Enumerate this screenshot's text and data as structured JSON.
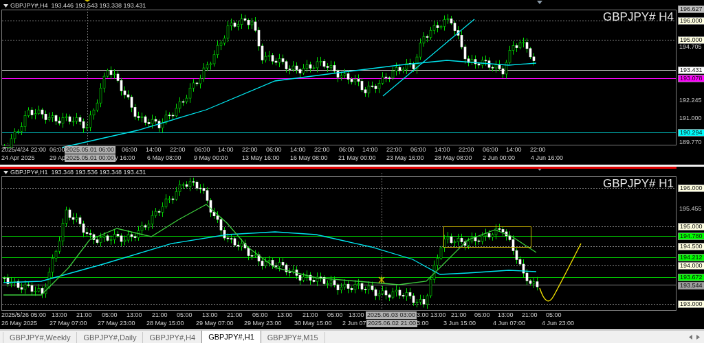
{
  "panes": [
    {
      "header": "GBPJPY#,H4  193.446 193.543 193.338 193.431",
      "title": "GBPJPY# H4",
      "active": false,
      "price_labels": [
        {
          "text": "196.627",
          "kind": "tag",
          "color": "#c0c0c0"
        },
        {
          "text": "196.000",
          "kind": "tag",
          "color": "#ffffe1"
        },
        {
          "text": "195.000",
          "kind": "tag",
          "color": "#ffffe1"
        },
        {
          "text": "194.705",
          "kind": "plain"
        },
        {
          "text": "193.431",
          "kind": "tag",
          "color": "#ffffff"
        },
        {
          "text": "193.078",
          "kind": "tag",
          "color": "#ff00ff"
        },
        {
          "text": "192.245",
          "kind": "plain"
        },
        {
          "text": "191.000",
          "kind": "plain"
        },
        {
          "text": "190.294",
          "kind": "tag",
          "color": "#00ffff"
        },
        {
          "text": "189.770",
          "kind": "plain"
        }
      ],
      "time_row_1": [
        {
          "text": "2025/4/24 22:00",
          "kind": "tick"
        },
        {
          "text": "06:00",
          "kind": "tick"
        },
        {
          "text": "2025.05.01 06:00",
          "kind": "crosshair"
        },
        {
          "text": "06:00",
          "kind": "tick"
        },
        {
          "text": "14:00",
          "kind": "tick"
        },
        {
          "text": "22:00",
          "kind": "tick"
        },
        {
          "text": "06:00",
          "kind": "tick"
        },
        {
          "text": "14:00",
          "kind": "tick"
        },
        {
          "text": "22:00",
          "kind": "tick"
        },
        {
          "text": "06:00",
          "kind": "tick"
        },
        {
          "text": "14:00",
          "kind": "tick"
        },
        {
          "text": "22:00",
          "kind": "tick"
        },
        {
          "text": "06:00",
          "kind": "tick"
        },
        {
          "text": "14:00",
          "kind": "tick"
        },
        {
          "text": "22:00",
          "kind": "tick"
        },
        {
          "text": "06:00",
          "kind": "tick"
        },
        {
          "text": "14:00",
          "kind": "tick"
        },
        {
          "text": "22:00",
          "kind": "tick"
        },
        {
          "text": "06:00",
          "kind": "tick"
        },
        {
          "text": "14:00",
          "kind": "tick"
        },
        {
          "text": "22:00",
          "kind": "tick"
        }
      ],
      "time_row_2": [
        {
          "text": "24 Apr 2025",
          "kind": "tick"
        },
        {
          "text": "29 Ap",
          "kind": "tick"
        },
        {
          "text": "2025.05.01 00:00",
          "kind": "crosshair"
        },
        {
          "text": "y 16:00",
          "kind": "tick"
        },
        {
          "text": "6 May 08:00",
          "kind": "tick"
        },
        {
          "text": "9 May 00:00",
          "kind": "tick"
        },
        {
          "text": "13 May 16:00",
          "kind": "tick"
        },
        {
          "text": "16 May 08:00",
          "kind": "tick"
        },
        {
          "text": "21 May 00:00",
          "kind": "tick"
        },
        {
          "text": "23 May 16:00",
          "kind": "tick"
        },
        {
          "text": "28 May 08:00",
          "kind": "tick"
        },
        {
          "text": "2 Jun 00:00",
          "kind": "tick"
        },
        {
          "text": "4 Jun 16:00",
          "kind": "tick"
        }
      ]
    },
    {
      "header": "GBPJPY#,H1  193.348 193.536 193.348 193.431",
      "title": "GBPJPY# H1",
      "active": true,
      "price_labels": [
        {
          "text": "196.000",
          "kind": "tag",
          "color": "#ffffe1"
        },
        {
          "text": "195.455",
          "kind": "plain"
        },
        {
          "text": "195.000",
          "kind": "tag",
          "color": "#ffffe1"
        },
        {
          "text": "194.780",
          "kind": "tag",
          "color": "#00ff00"
        },
        {
          "text": "194.500",
          "kind": "tag",
          "color": "#ffffe1"
        },
        {
          "text": "194.212",
          "kind": "tag",
          "color": "#00ff00"
        },
        {
          "text": "194.000",
          "kind": "tag",
          "color": "#ffffe1"
        },
        {
          "text": "193.672",
          "kind": "tag",
          "color": "#00ff00"
        },
        {
          "text": "193.544",
          "kind": "tag",
          "color": "#a0a0a0"
        },
        {
          "text": "193.000",
          "kind": "tag",
          "color": "#ffffe1"
        }
      ],
      "time_row_1": [
        {
          "text": "2025/5/26 05:00",
          "kind": "tick"
        },
        {
          "text": "13:00",
          "kind": "tick"
        },
        {
          "text": "21:00",
          "kind": "tick"
        },
        {
          "text": "05:00",
          "kind": "tick"
        },
        {
          "text": "13:00",
          "kind": "tick"
        },
        {
          "text": "21:00",
          "kind": "tick"
        },
        {
          "text": "05:00",
          "kind": "tick"
        },
        {
          "text": "13:00",
          "kind": "tick"
        },
        {
          "text": "21:00",
          "kind": "tick"
        },
        {
          "text": "05:00",
          "kind": "tick"
        },
        {
          "text": "13:00",
          "kind": "tick"
        },
        {
          "text": "21:00",
          "kind": "tick"
        },
        {
          "text": "05:00",
          "kind": "tick"
        },
        {
          "text": "13:00",
          "kind": "tick"
        },
        {
          "text": "2025.06.03 03:00",
          "kind": "crosshair"
        },
        {
          "text": "3:00",
          "kind": "tick"
        },
        {
          "text": "13:00",
          "kind": "tick"
        },
        {
          "text": "21:00",
          "kind": "tick"
        },
        {
          "text": "05:00",
          "kind": "tick"
        },
        {
          "text": "13:00",
          "kind": "tick"
        },
        {
          "text": "21:00",
          "kind": "tick"
        },
        {
          "text": "05:00",
          "kind": "tick"
        }
      ],
      "time_row_2": [
        {
          "text": "26 May 2025",
          "kind": "tick"
        },
        {
          "text": "27 May 07:00",
          "kind": "tick"
        },
        {
          "text": "27 May 23:00",
          "kind": "tick"
        },
        {
          "text": "28 May 15:00",
          "kind": "tick"
        },
        {
          "text": "29 May 07:00",
          "kind": "tick"
        },
        {
          "text": "29 May 23:00",
          "kind": "tick"
        },
        {
          "text": "30 May 15:00",
          "kind": "tick"
        },
        {
          "text": "2 Jun 07",
          "kind": "tick"
        },
        {
          "text": "2025.06.02 21:00",
          "kind": "crosshair"
        },
        {
          "text": "3:00",
          "kind": "tick"
        },
        {
          "text": "3 Jun 15:00",
          "kind": "tick"
        },
        {
          "text": "4 Jun 07:00",
          "kind": "tick"
        },
        {
          "text": "4 Jun 23:00",
          "kind": "tick"
        }
      ]
    }
  ],
  "tabs": [
    {
      "label": "GBPJPY#,Weekly",
      "selected": false
    },
    {
      "label": "GBPJPY#,Daily",
      "selected": false
    },
    {
      "label": "GBPJPY#,H4",
      "selected": false
    },
    {
      "label": "GBPJPY#,H1",
      "selected": true
    },
    {
      "label": "GBPJPY#,M15",
      "selected": false
    }
  ]
}
